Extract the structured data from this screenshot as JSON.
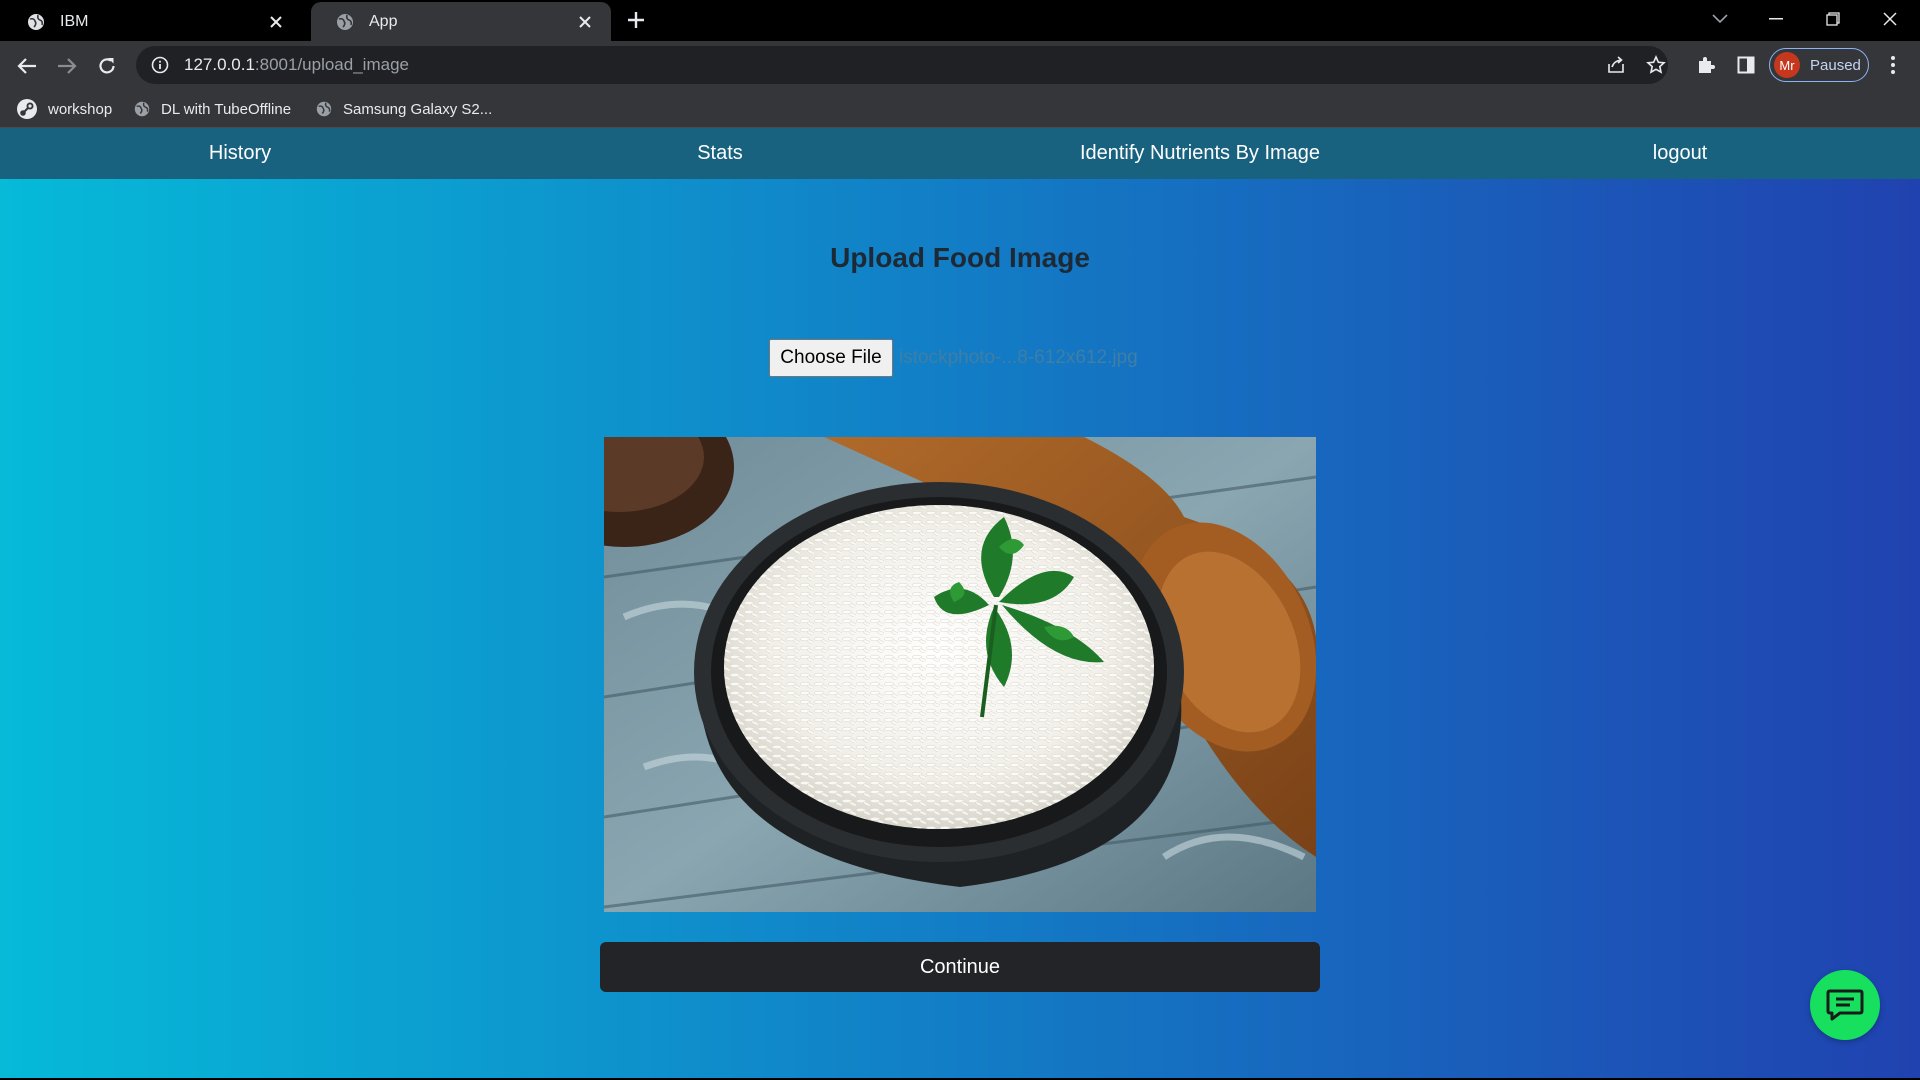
{
  "browser": {
    "tabs": [
      {
        "title": "IBM",
        "icon": "globe-icon",
        "active": false
      },
      {
        "title": "App",
        "icon": "globe-icon",
        "active": true
      }
    ],
    "url_host": "127.0.0.1",
    "url_rest": ":8001/upload_image",
    "profile_initials": "Mr",
    "profile_status": "Paused",
    "bookmarks": [
      {
        "label": "workshop",
        "icon": "steam-icon"
      },
      {
        "label": "DL with TubeOffline",
        "icon": "globe-icon"
      },
      {
        "label": "Samsung Galaxy S2...",
        "icon": "globe-icon"
      }
    ]
  },
  "app": {
    "nav": [
      "History",
      "Stats",
      "Identify Nutrients By Image",
      "logout"
    ],
    "heading": "Upload Food Image",
    "choose_file_label": "Choose File",
    "file_name": "istockphoto-...8-612x612.jpg",
    "preview_image": "bowl of white rice with parsley on wooden table",
    "continue_label": "Continue",
    "chat_icon": "chat-icon"
  },
  "colors": {
    "nav_bar": "#18627f",
    "gradient_start": "#06bad8",
    "gradient_end": "#2042b0",
    "continue_button": "#232427",
    "chat_fab": "#17e05e"
  }
}
